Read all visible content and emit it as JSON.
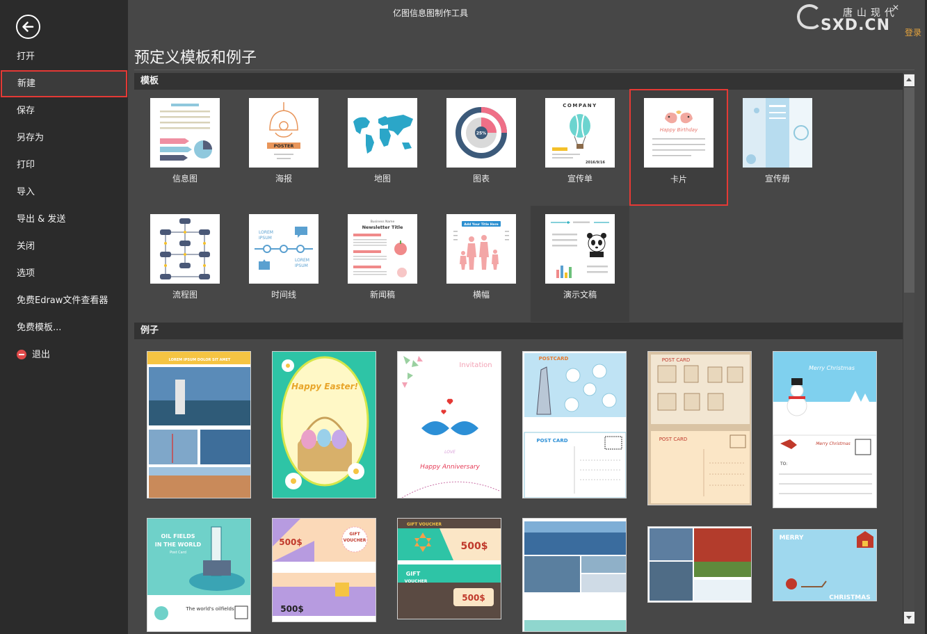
{
  "window": {
    "title": "亿图信息图制作工具",
    "login": "登录",
    "close_glyph": "✕"
  },
  "watermark": {
    "top": "唐山现代",
    "bottom": "SXD.CN"
  },
  "menu": [
    {
      "label": "打开"
    },
    {
      "label": "新建",
      "selected": true
    },
    {
      "label": "保存"
    },
    {
      "label": "另存为"
    },
    {
      "label": "打印"
    },
    {
      "label": "导入"
    },
    {
      "label": "导出 & 发送"
    },
    {
      "label": "关闭"
    },
    {
      "label": "选项"
    },
    {
      "label": "免费Edraw文件查看器"
    },
    {
      "label": "免费模板..."
    },
    {
      "label": "退出"
    }
  ],
  "page": {
    "title": "预定义模板和例子"
  },
  "sections": {
    "templates": "模板",
    "examples": "例子"
  },
  "templates": [
    {
      "label": "信息图"
    },
    {
      "label": "海报",
      "poster_text": "POSTER"
    },
    {
      "label": "地图"
    },
    {
      "label": "图表",
      "chart_text": "25%"
    },
    {
      "label": "宣传单",
      "company_text": "COMPANY",
      "date_text": "2016/9/16"
    },
    {
      "label": "卡片",
      "selected": true,
      "card_text": "Happy Birthday"
    },
    {
      "label": "宣传册"
    },
    {
      "label": "流程图"
    },
    {
      "label": "时间线",
      "lorem": "LOREM",
      "ipsum": "IPSUM"
    },
    {
      "label": "新闻稿",
      "name_text": "Business Name",
      "newsletter_text": "Newsletter Title"
    },
    {
      "label": "横幅",
      "banner_text": "Add Your Title Here"
    },
    {
      "label": "演示文稿",
      "hover": true
    }
  ],
  "examples": [
    {
      "name": "travel-brochure",
      "heading": "LOREM IPSUM DOLOR SIT AMET"
    },
    {
      "name": "easter-card",
      "text": "Happy Easter!"
    },
    {
      "name": "anniversary-invitation",
      "text": "Invitation",
      "sub": "Happy Anniversary",
      "love": "LOVE"
    },
    {
      "name": "postcard-travel",
      "text": "POSTCARD",
      "text2": "POST CARD"
    },
    {
      "name": "postcard-architecture",
      "text": "POST CARD",
      "text2": "POST CARD"
    },
    {
      "name": "christmas-postcard",
      "text": "Merry Christmas",
      "text2": "Merry Christmas",
      "to": "TO:"
    },
    {
      "name": "oil-fields-postcard",
      "text": "OIL FIELDS",
      "text2": "IN THE WORLD",
      "text3": "Post Card",
      "text4": "The world's oilfields"
    },
    {
      "name": "gift-voucher-pastel",
      "text": "GIFT",
      "text2": "VOUCHER",
      "price": "500$",
      "price2": "500$"
    },
    {
      "name": "gift-voucher-dark",
      "text": "GIFT VOUCHER",
      "price": "500$",
      "text2": "GIFT",
      "text3": "VOUCHER",
      "price2": "500$"
    },
    {
      "name": "photo-collage-lake"
    },
    {
      "name": "photo-collage-harbor"
    },
    {
      "name": "merry-christmas-card",
      "text": "MERRY",
      "text2": "CHRISTMAS"
    }
  ]
}
